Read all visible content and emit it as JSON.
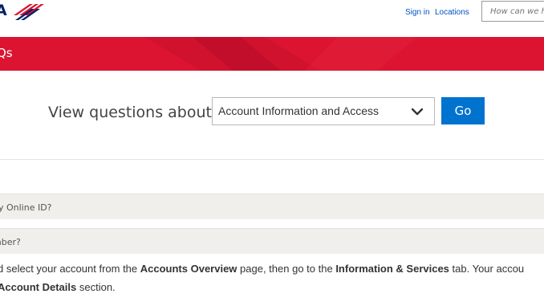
{
  "header": {
    "logo_letter": "A",
    "sign_in": "Sign in",
    "locations": "Locations",
    "search_placeholder": "How can we h"
  },
  "banner": {
    "title": "Qs"
  },
  "selector": {
    "label": "View questions about:",
    "selected": "Account Information and Access",
    "go": "Go"
  },
  "faq": {
    "q1": "ny Online ID?",
    "q2": "mber?",
    "answer_line1": {
      "a": "d select your account from the ",
      "b1": "Accounts Overview",
      "c": " page, then go to the ",
      "b2": "Information & Services",
      "d": " tab. Your accou"
    },
    "answer_line2": {
      "b3": "Account Details",
      "e": " section."
    }
  },
  "colors": {
    "brand_red": "#dc1431",
    "brand_navy": "#012169",
    "link_blue": "#0052c2",
    "button_blue": "#0073cf"
  }
}
